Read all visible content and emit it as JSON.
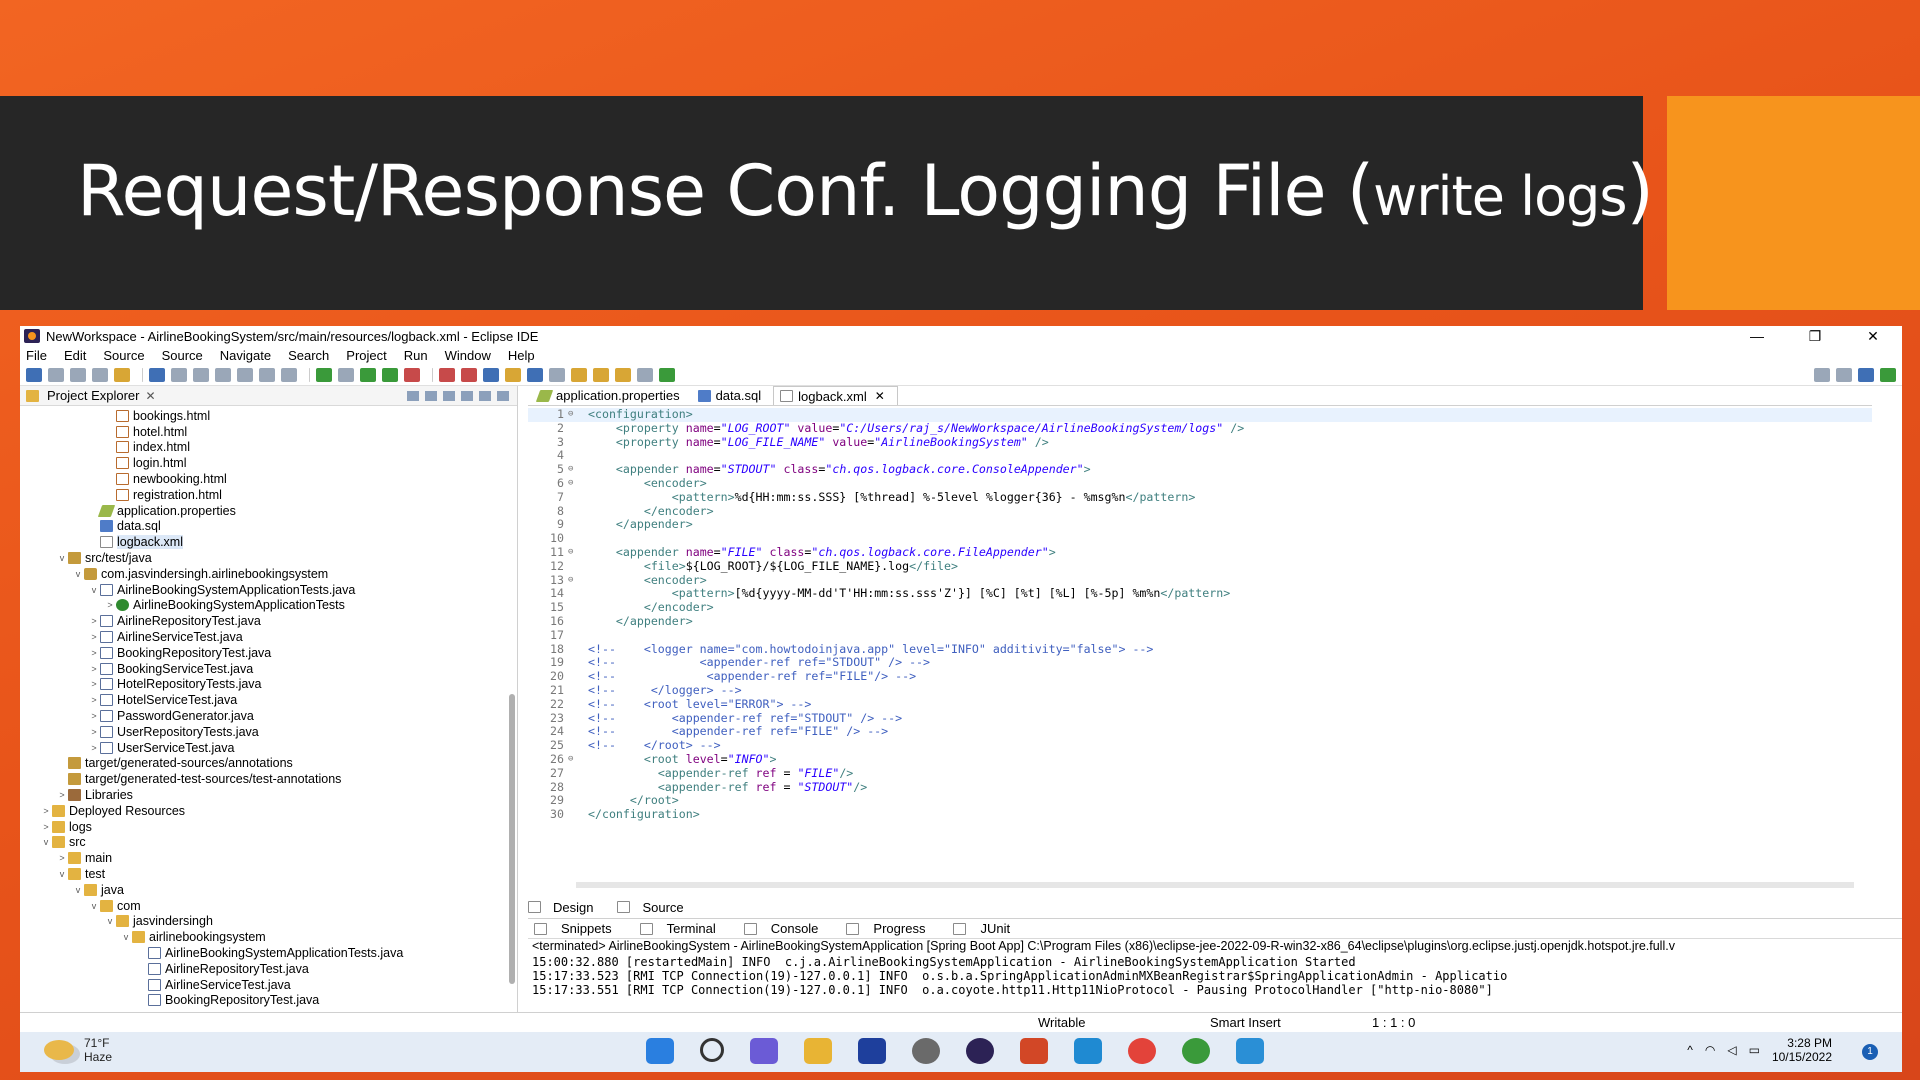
{
  "slide": {
    "title_main": "Request/Response Conf. Logging File (",
    "title_small": "write logs",
    "title_end": ")"
  },
  "window": {
    "title": "NewWorkspace - AirlineBookingSystem/src/main/resources/logback.xml - Eclipse IDE",
    "minimize": "—",
    "restore": "❐",
    "close": "✕"
  },
  "menu": [
    "File",
    "Edit",
    "Source",
    "Source",
    "Navigate",
    "Search",
    "Project",
    "Run",
    "Window",
    "Help"
  ],
  "explorer": {
    "tab_label": "Project Explorer",
    "close": "✕",
    "tree": [
      {
        "text": "bookings.html",
        "indent": 5,
        "icon": "html",
        "tw": ""
      },
      {
        "text": "hotel.html",
        "indent": 5,
        "icon": "html",
        "tw": ""
      },
      {
        "text": "index.html",
        "indent": 5,
        "icon": "html",
        "tw": ""
      },
      {
        "text": "login.html",
        "indent": 5,
        "icon": "html",
        "tw": ""
      },
      {
        "text": "newbooking.html",
        "indent": 5,
        "icon": "html",
        "tw": ""
      },
      {
        "text": "registration.html",
        "indent": 5,
        "icon": "html",
        "tw": ""
      },
      {
        "text": "application.properties",
        "indent": 4,
        "icon": "prop",
        "tw": ""
      },
      {
        "text": "data.sql",
        "indent": 4,
        "icon": "sql",
        "tw": ""
      },
      {
        "text": "logback.xml",
        "indent": 4,
        "icon": "xml",
        "tw": "",
        "selected": true
      },
      {
        "text": "src/test/java",
        "indent": 2,
        "icon": "src",
        "tw": "v"
      },
      {
        "text": "com.jasvindersingh.airlinebookingsystem",
        "indent": 3,
        "icon": "pkg",
        "tw": "v"
      },
      {
        "text": "AirlineBookingSystemApplicationTests.java",
        "indent": 4,
        "icon": "java",
        "tw": "v"
      },
      {
        "text": "AirlineBookingSystemApplicationTests",
        "indent": 5,
        "icon": "test",
        "tw": ">"
      },
      {
        "text": "AirlineRepositoryTest.java",
        "indent": 4,
        "icon": "java",
        "tw": ">"
      },
      {
        "text": "AirlineServiceTest.java",
        "indent": 4,
        "icon": "java",
        "tw": ">"
      },
      {
        "text": "BookingRepositoryTest.java",
        "indent": 4,
        "icon": "java",
        "tw": ">"
      },
      {
        "text": "BookingServiceTest.java",
        "indent": 4,
        "icon": "java",
        "tw": ">"
      },
      {
        "text": "HotelRepositoryTests.java",
        "indent": 4,
        "icon": "java",
        "tw": ">"
      },
      {
        "text": "HotelServiceTest.java",
        "indent": 4,
        "icon": "java",
        "tw": ">"
      },
      {
        "text": "PasswordGenerator.java",
        "indent": 4,
        "icon": "java",
        "tw": ">"
      },
      {
        "text": "UserRepositoryTests.java",
        "indent": 4,
        "icon": "java",
        "tw": ">"
      },
      {
        "text": "UserServiceTest.java",
        "indent": 4,
        "icon": "java",
        "tw": ">"
      },
      {
        "text": "target/generated-sources/annotations",
        "indent": 2,
        "icon": "src",
        "tw": ""
      },
      {
        "text": "target/generated-test-sources/test-annotations",
        "indent": 2,
        "icon": "src",
        "tw": ""
      },
      {
        "text": "Libraries",
        "indent": 2,
        "icon": "lib",
        "tw": ">"
      },
      {
        "text": "Deployed Resources",
        "indent": 1,
        "icon": "folder",
        "tw": ">"
      },
      {
        "text": "logs",
        "indent": 1,
        "icon": "folder",
        "tw": ">"
      },
      {
        "text": "src",
        "indent": 1,
        "icon": "folder",
        "tw": "v"
      },
      {
        "text": "main",
        "indent": 2,
        "icon": "folder",
        "tw": ">"
      },
      {
        "text": "test",
        "indent": 2,
        "icon": "folder",
        "tw": "v"
      },
      {
        "text": "java",
        "indent": 3,
        "icon": "folder",
        "tw": "v"
      },
      {
        "text": "com",
        "indent": 4,
        "icon": "folder",
        "tw": "v"
      },
      {
        "text": "jasvindersingh",
        "indent": 5,
        "icon": "folder",
        "tw": "v"
      },
      {
        "text": "airlinebookingsystem",
        "indent": 6,
        "icon": "folder",
        "tw": "v"
      },
      {
        "text": "AirlineBookingSystemApplicationTests.java",
        "indent": 7,
        "icon": "java",
        "tw": ""
      },
      {
        "text": "AirlineRepositoryTest.java",
        "indent": 7,
        "icon": "java",
        "tw": ""
      },
      {
        "text": "AirlineServiceTest.java",
        "indent": 7,
        "icon": "java",
        "tw": ""
      },
      {
        "text": "BookingRepositoryTest.java",
        "indent": 7,
        "icon": "java",
        "tw": ""
      }
    ]
  },
  "editor": {
    "tabs": [
      {
        "label": "application.properties",
        "icon": "prop",
        "active": false
      },
      {
        "label": "data.sql",
        "icon": "sql",
        "active": false
      },
      {
        "label": "logback.xml",
        "icon": "xml",
        "active": true
      }
    ],
    "tab_close": "✕",
    "lines": [
      {
        "n": "1",
        "f": "⊖",
        "t": "<configuration>"
      },
      {
        "n": "2",
        "f": "",
        "t": "    <property name=\"LOG_ROOT\" value=\"C:/Users/raj_s/NewWorkspace/AirlineBookingSystem/logs\" />"
      },
      {
        "n": "3",
        "f": "",
        "t": "    <property name=\"LOG_FILE_NAME\" value=\"AirlineBookingSystem\" />"
      },
      {
        "n": "4",
        "f": "",
        "t": ""
      },
      {
        "n": "5",
        "f": "⊖",
        "t": "    <appender name=\"STDOUT\" class=\"ch.qos.logback.core.ConsoleAppender\">"
      },
      {
        "n": "6",
        "f": "⊖",
        "t": "        <encoder>"
      },
      {
        "n": "7",
        "f": "",
        "t": "            <pattern>%d{HH:mm:ss.SSS} [%thread] %-5level %logger{36} - %msg%n</pattern>"
      },
      {
        "n": "8",
        "f": "",
        "t": "        </encoder>"
      },
      {
        "n": "9",
        "f": "",
        "t": "    </appender>"
      },
      {
        "n": "10",
        "f": "",
        "t": ""
      },
      {
        "n": "11",
        "f": "⊖",
        "t": "    <appender name=\"FILE\" class=\"ch.qos.logback.core.FileAppender\">"
      },
      {
        "n": "12",
        "f": "",
        "t": "        <file>${LOG_ROOT}/${LOG_FILE_NAME}.log</file>"
      },
      {
        "n": "13",
        "f": "⊖",
        "t": "        <encoder>"
      },
      {
        "n": "14",
        "f": "",
        "t": "            <pattern>[%d{yyyy-MM-dd'T'HH:mm:ss.sss'Z'}] [%C] [%t] [%L] [%-5p] %m%n</pattern>"
      },
      {
        "n": "15",
        "f": "",
        "t": "        </encoder>"
      },
      {
        "n": "16",
        "f": "",
        "t": "    </appender>"
      },
      {
        "n": "17",
        "f": "",
        "t": ""
      },
      {
        "n": "18",
        "f": "",
        "t": "<!--    <logger name=\"com.howtodoinjava.app\" level=\"INFO\" additivity=\"false\"> -->"
      },
      {
        "n": "19",
        "f": "",
        "t": "<!--            <appender-ref ref=\"STDOUT\" /> -->"
      },
      {
        "n": "20",
        "f": "",
        "t": "<!--             <appender-ref ref=\"FILE\"/> -->"
      },
      {
        "n": "21",
        "f": "",
        "t": "<!--     </logger> -->"
      },
      {
        "n": "22",
        "f": "",
        "t": "<!--    <root level=\"ERROR\"> -->"
      },
      {
        "n": "23",
        "f": "",
        "t": "<!--        <appender-ref ref=\"STDOUT\" /> -->"
      },
      {
        "n": "24",
        "f": "",
        "t": "<!--        <appender-ref ref=\"FILE\" /> -->"
      },
      {
        "n": "25",
        "f": "",
        "t": "<!--    </root> -->"
      },
      {
        "n": "26",
        "f": "⊖",
        "t": "        <root level=\"INFO\">"
      },
      {
        "n": "27",
        "f": "",
        "t": "          <appender-ref ref = \"FILE\"/>"
      },
      {
        "n": "28",
        "f": "",
        "t": "          <appender-ref ref = \"STDOUT\"/>"
      },
      {
        "n": "29",
        "f": "",
        "t": "      </root>"
      },
      {
        "n": "30",
        "f": "",
        "t": "</configuration>"
      }
    ],
    "design_tab": "Design",
    "source_tab": "Source"
  },
  "console": {
    "tabs": [
      "Snippets",
      "Terminal",
      "Console",
      "Progress",
      "JUnit"
    ],
    "active_tab": "Console",
    "terminated": "<terminated> AirlineBookingSystem - AirlineBookingSystemApplication [Spring Boot App] C:\\Program Files (x86)\\eclipse-jee-2022-09-R-win32-x86_64\\eclipse\\plugins\\org.eclipse.justj.openjdk.hotspot.jre.full.v",
    "lines": [
      "15:00:32.880 [restartedMain] INFO  c.j.a.AirlineBookingSystemApplication - AirlineBookingSystemApplication Started",
      "15:17:33.523 [RMI TCP Connection(19)-127.0.0.1] INFO  o.s.b.a.SpringApplicationAdminMXBeanRegistrar$SpringApplicationAdmin - Applicatio",
      "15:17:33.551 [RMI TCP Connection(19)-127.0.0.1] INFO  o.a.coyote.http11.Http11NioProtocol - Pausing ProtocolHandler [\"http-nio-8080\"]"
    ]
  },
  "status": {
    "writable": "Writable",
    "insert": "Smart Insert",
    "position": "1 : 1 : 0"
  },
  "taskbar": {
    "temp": "71°F",
    "weather": "Haze",
    "time": "3:28 PM",
    "date": "10/15/2022",
    "notifications": "1"
  },
  "colors": {
    "slide_band": "#262626",
    "accent_orange": "#f7941d",
    "background_orange": "#e8541a"
  }
}
